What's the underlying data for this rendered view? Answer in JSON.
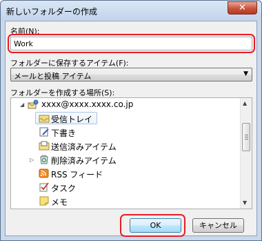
{
  "window": {
    "title": "新しいフォルダーの作成",
    "close_glyph": "✕"
  },
  "name_field": {
    "label": "名前(N):",
    "value": "Work"
  },
  "contains": {
    "label": "フォルダーに保存するアイテム(F):",
    "selected": "メールと投稿 アイテム"
  },
  "location": {
    "label": "フォルダーを作成する場所(S):",
    "tree": [
      {
        "label": "xxxx@xxxx.xxxx.co.jp",
        "icon": "mail-account-icon",
        "expander": "◢"
      },
      {
        "label": "受信トレイ",
        "icon": "inbox-icon",
        "expander": ""
      },
      {
        "label": "下書き",
        "icon": "drafts-icon",
        "expander": ""
      },
      {
        "label": "送信済みアイテム",
        "icon": "sent-items-icon",
        "expander": ""
      },
      {
        "label": "削除済みアイテム",
        "icon": "deleted-items-icon",
        "expander": "▷"
      },
      {
        "label": "RSS フィード",
        "icon": "rss-icon",
        "expander": ""
      },
      {
        "label": "タスク",
        "icon": "tasks-icon",
        "expander": ""
      },
      {
        "label": "メモ",
        "icon": "notes-icon",
        "expander": ""
      }
    ]
  },
  "buttons": {
    "ok": "OK",
    "cancel": "キャンセル"
  },
  "colors": {
    "highlight_ring": "#e81c24",
    "selection_fill": "#e9f2fc"
  }
}
